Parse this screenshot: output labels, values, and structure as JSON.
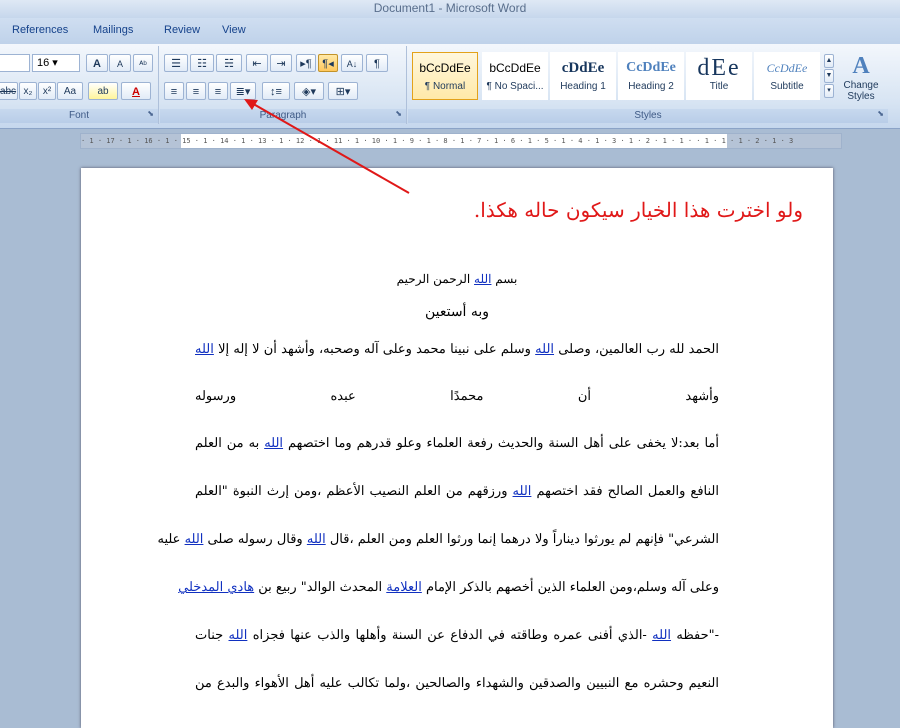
{
  "window": {
    "title": "Document1 - Microsoft Word"
  },
  "tabs": [
    "References",
    "Mailings",
    "Review",
    "View"
  ],
  "font": {
    "size": "16",
    "group_label": "Font",
    "grow": "A",
    "shrink": "A",
    "clear": "Aa"
  },
  "paragraph": {
    "group_label": "Paragraph",
    "sort": "A↓",
    "show_marks": "¶"
  },
  "styles": {
    "group_label": "Styles",
    "items": [
      {
        "preview": "bCcDdEe",
        "name": "¶ Normal"
      },
      {
        "preview": "bCcDdEe",
        "name": "¶ No Spaci..."
      },
      {
        "preview": "cDdEe",
        "name": "Heading 1"
      },
      {
        "preview": "CcDdEe",
        "name": "Heading 2"
      },
      {
        "preview": "dEe",
        "name": "Title"
      },
      {
        "preview": "CcDdEe",
        "name": "Subtitle"
      }
    ],
    "change_styles": "Change Styles"
  },
  "ruler": {
    "text": "· 1 · 17 · 1 · 16 · 1 · 15 · 1 · 14 · 1 · 13 · 1 · 12 · 1 · 11 · 1 · 10 · 1 · 9 · 1 · 8 · 1 · 7 · 1 · 6 · 1 · 5 · 1 · 4 · 1 · 3 · 1 · 2 · 1 · 1 ·   · 1 · 1 · 1 · 2 · 1 · 3"
  },
  "document": {
    "annotation": "ولو اخترت هذا الخيار سيكون حاله هكذا.",
    "basmala": {
      "pre": "بسم ",
      "link": "الله",
      "post": " الرحمن الرحيم"
    },
    "subtitle": "وبه أستعين",
    "lines": [
      {
        "pre": "الحمد لله رب العالمين، وصلى ",
        "link": "الله",
        "post": " وسلم على نبينا محمد وعلى آله وصحبه، وأشهد أن لا إله إلا ",
        "link2": "الله",
        "post2": ""
      },
      {
        "pre": "وأشهد    أن    محمدًا    عبده    ورسوله",
        "link": "",
        "post": ""
      },
      {
        "pre": "أما بعد:لا يخفى على أهل السنة والحديث رفعة العلماء وعلو قدرهم وما اختصهم ",
        "link": "الله",
        "post": " به من العلم"
      },
      {
        "pre": "النافع والعمل الصالح فقد اختصهم ",
        "link": "الله",
        "post": " ورزقهم من العلم النصيب الأعظم ،ومن إرث النبوة \"العلم"
      },
      {
        "pre": "الشرعي\" فإنهم لم يورثوا ديناراً ولا درهما إنما ورثوا العلم ومن العلم ،قال ",
        "link": "الله",
        "post": " وقال رسوله صلى ",
        "link2": "الله",
        "post2": " عليه"
      },
      {
        "pre": "وعلى آله وسلم،ومن العلماء الذين أخصهم بالذكر الإمام ",
        "link": "العلامة",
        "post": " المحدث الوالد\" ربيع بن ",
        "link2": "هادي المدخلي",
        "post2": ""
      },
      {
        "pre": "-\"حفظه ",
        "link": "الله",
        "post": " -الذي أفنى عمره وطاقته في الدفاع عن السنة وأهلها والذب عنها فجزاه ",
        "link2": "الله",
        "post2": " جنات"
      },
      {
        "pre": "النعيم وحشره مع النبيين والصدقين والشهداء والصالحين ،ولما تكالب عليه أهل الأهواء والبدع من",
        "link": "",
        "post": ""
      }
    ]
  },
  "colors": {
    "annotation": "#e01818",
    "link": "#1030c0",
    "ribbon": "#d7e4f3"
  }
}
